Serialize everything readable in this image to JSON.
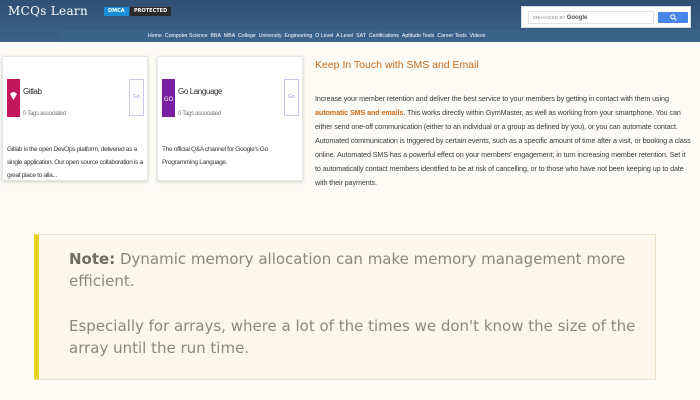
{
  "header": {
    "brand": "MCQs Learn",
    "dmca_badge": "DMCA",
    "protected_badge": "PROTECTED",
    "nav_items": [
      "Home",
      "Computer Science",
      "BBA",
      "MBA",
      "College",
      "University",
      "Engineering",
      "O Level",
      "A Level",
      "SAT",
      "Certifications",
      "Aptitude Tests",
      "Career Tests",
      "Videos"
    ],
    "search": {
      "enhanced_by": "ENHANCED BY",
      "google": "Google",
      "button_color": "#4a86e8"
    }
  },
  "cards": [
    {
      "title": "Gitlab",
      "subtitle": "0 Tags associated",
      "goto": "Go",
      "description": "Gitlab is the open DevOps platform, delivered as a single application. Our open source collaboration is a great place to alla...",
      "logo_color": "#c2185b"
    },
    {
      "title": "Go Language",
      "subtitle": "0 Tags associated",
      "goto": "Go",
      "description": "The official Q&A channel for Google's Go Programming Language.",
      "logo_color": "#7b1fa2"
    }
  ],
  "sms": {
    "title": "Keep In Touch with SMS and Email",
    "body_before": "Increase your member retention and deliver the best service to your members by getting in contact with them using ",
    "body_highlight": "automatic SMS and emails",
    "body_after": ". This works directly within GymMaster, as well as working from your smartphone. You can either send one-off communication (either to an individual or a group as defined by you), or you can automate contact. Automated communication is triggered by certain events, such as a specific amount of time after a visit, or booking a class online. Automated SMS has a powerful effect on your members' engagement; in turn increasing member retention. Set it to automatically contact members identified to be at risk of cancelling, or to those who have not been keeping up to date with their payments."
  },
  "note": {
    "label": "Note:",
    "line1": " Dynamic memory allocation can make memory management more efficient.",
    "line2": "Especially for arrays, where a lot of the times we don't know the size of the array until the run time."
  }
}
